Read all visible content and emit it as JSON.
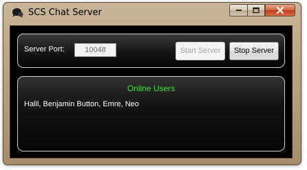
{
  "window": {
    "title": "SCS Chat Server",
    "icon": "chat-bubbles-icon"
  },
  "controls": {
    "minimize_icon": "minimize-icon",
    "maximize_icon": "maximize-icon",
    "close_icon": "close-icon"
  },
  "server": {
    "port_label": "Server Port:",
    "port_value": "10048",
    "start_label": "Start Server",
    "stop_label": "Stop Server"
  },
  "users": {
    "title": "Online Users",
    "list": "Halil, Benjamin Button, Emre, Neo"
  },
  "colors": {
    "online_title": "#33ee33",
    "frame": "#b9a283",
    "client_bg": "#000000"
  }
}
